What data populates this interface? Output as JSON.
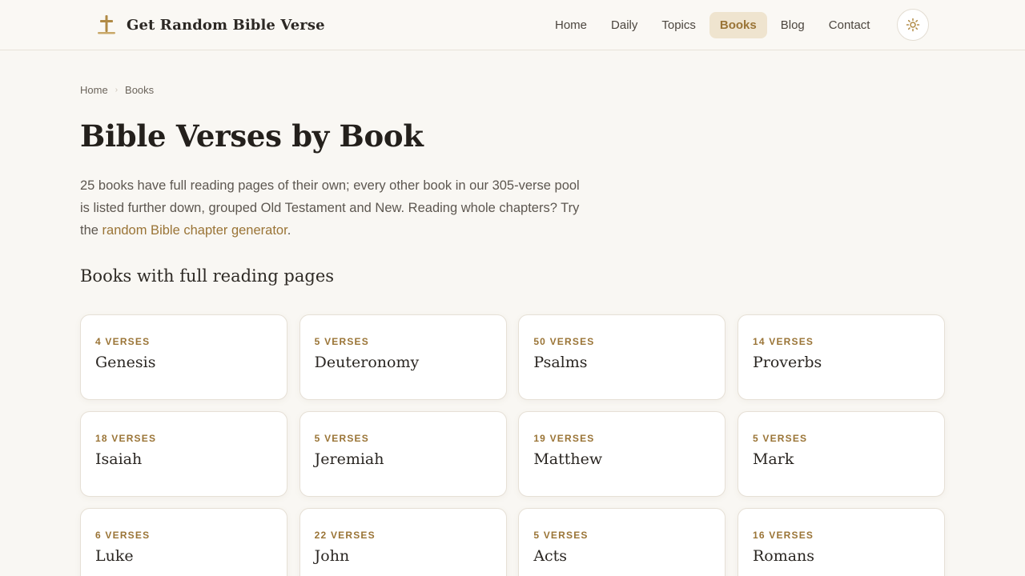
{
  "header": {
    "brand_name": "Get Random Bible Verse",
    "nav": [
      {
        "label": "Home",
        "active": false
      },
      {
        "label": "Daily",
        "active": false
      },
      {
        "label": "Topics",
        "active": false
      },
      {
        "label": "Books",
        "active": true
      },
      {
        "label": "Blog",
        "active": false
      },
      {
        "label": "Contact",
        "active": false
      }
    ]
  },
  "breadcrumb": {
    "home": "Home",
    "current": "Books"
  },
  "page": {
    "title": "Bible Verses by Book",
    "intro_text": "25 books have full reading pages of their own; every other book in our 305-verse pool is listed further down, grouped Old Testament and New. Reading whole chapters? Try the ",
    "intro_link": "random Bible chapter generator",
    "intro_end": ".",
    "section_title": "Books with full reading pages"
  },
  "books": [
    {
      "count": "4 verses",
      "name": "Genesis"
    },
    {
      "count": "5 verses",
      "name": "Deuteronomy"
    },
    {
      "count": "50 verses",
      "name": "Psalms"
    },
    {
      "count": "14 verses",
      "name": "Proverbs"
    },
    {
      "count": "18 verses",
      "name": "Isaiah"
    },
    {
      "count": "5 verses",
      "name": "Jeremiah"
    },
    {
      "count": "19 verses",
      "name": "Matthew"
    },
    {
      "count": "5 verses",
      "name": "Mark"
    },
    {
      "count": "6 verses",
      "name": "Luke"
    },
    {
      "count": "22 verses",
      "name": "John"
    },
    {
      "count": "5 verses",
      "name": "Acts"
    },
    {
      "count": "16 verses",
      "name": "Romans"
    }
  ],
  "colors": {
    "accent": "#9a7436",
    "background": "#f9f7f3",
    "active_nav_bg": "#efe4cf"
  },
  "icons": {
    "brand": "cross-icon",
    "theme": "sun-icon",
    "breadcrumb_sep": "chevron-right-icon"
  }
}
